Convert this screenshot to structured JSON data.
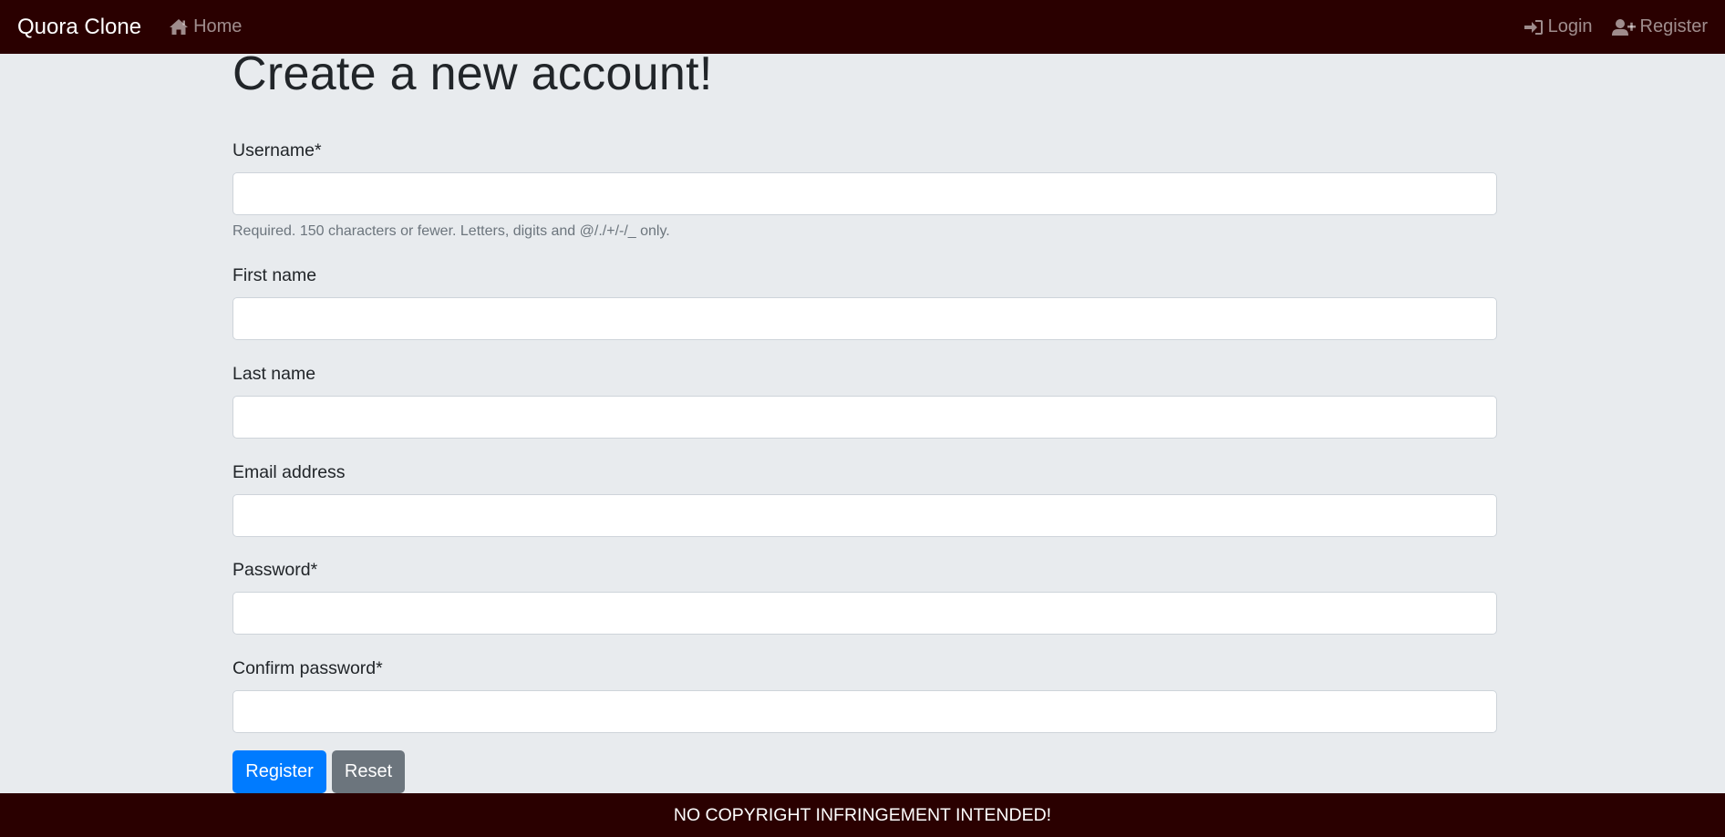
{
  "navbar": {
    "brand": "Quora Clone",
    "home_label": "Home",
    "login_label": "Login",
    "register_label": "Register",
    "icons": [
      "home-icon",
      "sign-in-icon",
      "user-plus-icon"
    ]
  },
  "page": {
    "title": "Create a new account!"
  },
  "form": {
    "username": {
      "label": "Username*",
      "value": "",
      "help": "Required. 150 characters or fewer. Letters, digits and @/./+/-/_ only."
    },
    "first_name": {
      "label": "First name",
      "value": ""
    },
    "last_name": {
      "label": "Last name",
      "value": ""
    },
    "email": {
      "label": "Email address",
      "value": ""
    },
    "password": {
      "label": "Password*",
      "value": ""
    },
    "confirm_password": {
      "label": "Confirm password*",
      "value": ""
    },
    "register_button": "Register",
    "reset_button": "Reset"
  },
  "footer": {
    "text": "NO COPYRIGHT INFRINGEMENT INTENDED!"
  },
  "colors": {
    "navbar_bg": "#2a0000",
    "page_bg": "#e8ebee",
    "primary": "#007bff",
    "secondary": "#6c757d"
  }
}
